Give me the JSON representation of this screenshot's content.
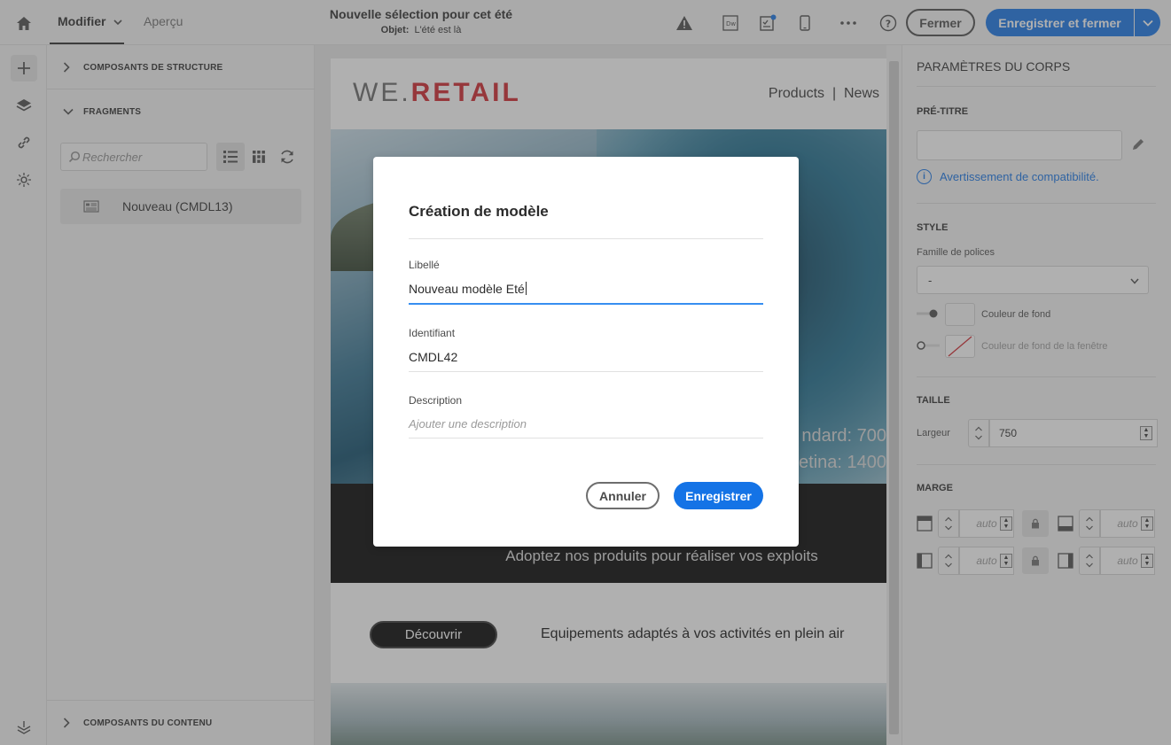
{
  "topbar": {
    "tabs": [
      {
        "label": "Modifier"
      },
      {
        "label": "Aperçu"
      }
    ],
    "title": "Nouvelle sélection pour cet été",
    "subject_label": "Objet:",
    "subject_value": "L'été est là",
    "icons": [
      "warning-icon",
      "dreamweaver-icon",
      "checklist-icon",
      "mobile-icon",
      "more-icon",
      "help-icon"
    ],
    "close_label": "Fermer",
    "save_close_label": "Enregistrer et fermer"
  },
  "left_rail": {
    "icons": [
      "add-icon",
      "layers-icon",
      "link-icon",
      "personalization-icon",
      "settings-icon"
    ]
  },
  "left_panel": {
    "sections": {
      "structure": "COMPOSANTS DE STRUCTURE",
      "fragments": "FRAGMENTS",
      "content": "COMPOSANTS DU CONTENU"
    },
    "search_placeholder": "Rechercher",
    "fragment_items": [
      {
        "label": "Nouveau (CMDL13)"
      }
    ]
  },
  "email": {
    "logo_we": "WE.",
    "logo_retail": "RETAIL",
    "nav": "Products  |  News",
    "hero_text_1": "ndard: 700",
    "hero_text_2": "etina: 1400",
    "band_text": "Adoptez nos produits pour réaliser vos exploits",
    "cta_label": "Découvrir",
    "cta_text": "Equipements adaptés à vos activités en plein air"
  },
  "right_panel": {
    "title": "PARAMÈTRES DU CORPS",
    "pretitle_caption": "PRÉ-TITRE",
    "compat_warning": "Avertissement de compatibilité.",
    "style_caption": "STYLE",
    "font_family_label": "Famille de polices",
    "font_family_value": "-",
    "bg_color_label": "Couleur de fond",
    "window_bg_color_label": "Couleur de fond de la fenêtre",
    "size_caption": "TAILLE",
    "width_label": "Largeur",
    "width_value": "750",
    "margin_caption": "MARGE",
    "margin_values": [
      "auto",
      "auto",
      "auto",
      "auto"
    ]
  },
  "dialog": {
    "title": "Création de modèle",
    "label_caption": "Libellé",
    "label_value": "Nouveau modèle Eté",
    "id_caption": "Identifiant",
    "id_value": "CMDL42",
    "desc_caption": "Description",
    "desc_placeholder": "Ajouter une description",
    "cancel_label": "Annuler",
    "save_label": "Enregistrer"
  },
  "colors": {
    "accent": "#1473e6",
    "brand_red": "#d0232b"
  }
}
